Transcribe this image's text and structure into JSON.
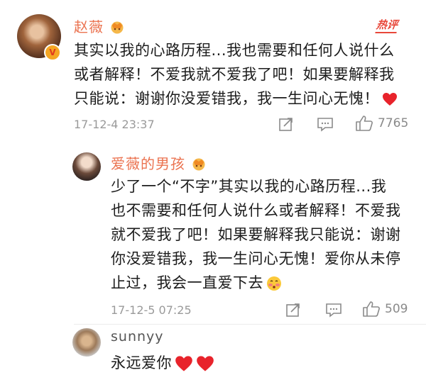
{
  "comments": [
    {
      "username": "赵薇",
      "badge": "V",
      "hot_label": "热评",
      "lines": [
        "其实以我的心路历程...我也需要和任何人说什么",
        "或者解释！不爱我就不爱我了吧！如果要解释我",
        "只能说：谢谢你没爱错我，我一生问心无愧！"
      ],
      "timestamp": "17-12-4 23:37",
      "likes": "7765"
    },
    {
      "username": "爱薇的男孩",
      "lines": [
        "少了一个“不字”其实以我的心路历程...我",
        "也不需要和任何人说什么或者解释！不爱我",
        "就不爱我了吧！如果要解释我只能说：谢谢",
        "你没爱错我，我一生问心无愧！爱你从未停",
        "止过，我会一直爱下去"
      ],
      "timestamp": "17-12-5 07:25",
      "likes": "509"
    },
    {
      "username": "sunnyy",
      "lines": [
        "永远爱你"
      ]
    }
  ],
  "colors": {
    "username": "#eb7350",
    "meta": "#9a9a9a",
    "heart": "#e8232b",
    "hot": "#e8473a"
  },
  "icons": [
    "share-icon",
    "comment-icon",
    "like-icon",
    "heart-emoji",
    "crown-badge-icon",
    "blush-emoji"
  ]
}
